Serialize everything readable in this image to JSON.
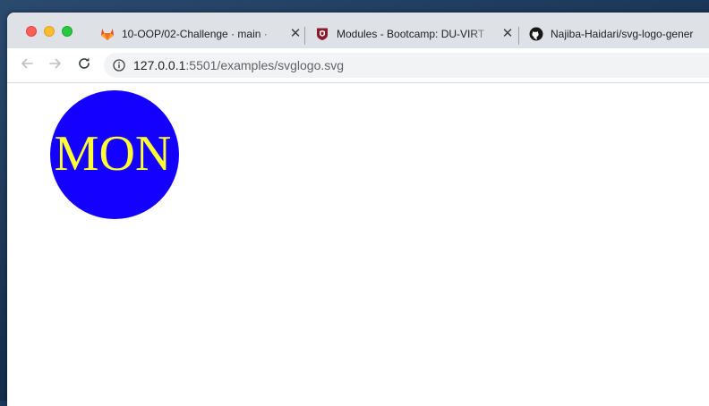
{
  "browser": {
    "tabs": [
      {
        "title": "10-OOP/02-Challenge · main · ",
        "favicon": "gitlab-icon"
      },
      {
        "title": "Modules - Bootcamp: DU-VIRT",
        "favicon": "university-shield-icon"
      },
      {
        "title": "Najiba-Haidari/svg-logo-gener",
        "favicon": "github-icon"
      }
    ],
    "address": {
      "host": "127.0.0.1",
      "rest": ":5501/examples/svglogo.svg"
    }
  },
  "logo": {
    "text": "MON",
    "shape": "circle",
    "shape_color": "#1400ff",
    "text_color": "#ffff33"
  }
}
